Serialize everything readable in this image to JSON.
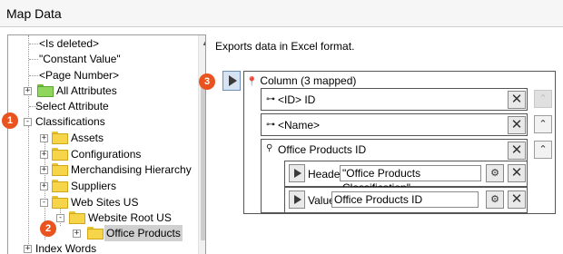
{
  "window": {
    "title": "Map Data"
  },
  "tree": {
    "items": [
      {
        "label": "<Is deleted>"
      },
      {
        "label": "\"Constant Value\""
      },
      {
        "label": "<Page Number>"
      },
      {
        "label": "All Attributes"
      },
      {
        "label": "Select Attribute"
      },
      {
        "label": "Classifications"
      },
      {
        "label": "Assets"
      },
      {
        "label": "Configurations"
      },
      {
        "label": "Merchandising Hierarchy"
      },
      {
        "label": "Suppliers"
      },
      {
        "label": "Web Sites US"
      },
      {
        "label": "Website Root US"
      },
      {
        "label": "Office Products"
      },
      {
        "label": "Index Words"
      }
    ],
    "selected": "Office Products"
  },
  "callouts": [
    "1",
    "2",
    "3"
  ],
  "panel": {
    "description": "Exports data in Excel format.",
    "column_label": "Column (3 mapped)",
    "fields": [
      {
        "label": "<ID> ID"
      },
      {
        "label": "<Name>"
      },
      {
        "label": "Office Products ID"
      }
    ],
    "subfields": [
      {
        "key": "Header",
        "value": "\"Office Products Classification\""
      },
      {
        "key": "Value",
        "value": "Office Products ID"
      }
    ]
  },
  "colors": {
    "callout": "#e8531f",
    "folder": "#f6d54a",
    "green_folder": "#8fd65c"
  },
  "icons": [
    "folder-icon",
    "plus-expander-icon",
    "minus-expander-icon",
    "pin-icon",
    "play-icon",
    "close-icon",
    "chevron-up-icon",
    "settings-icon"
  ]
}
